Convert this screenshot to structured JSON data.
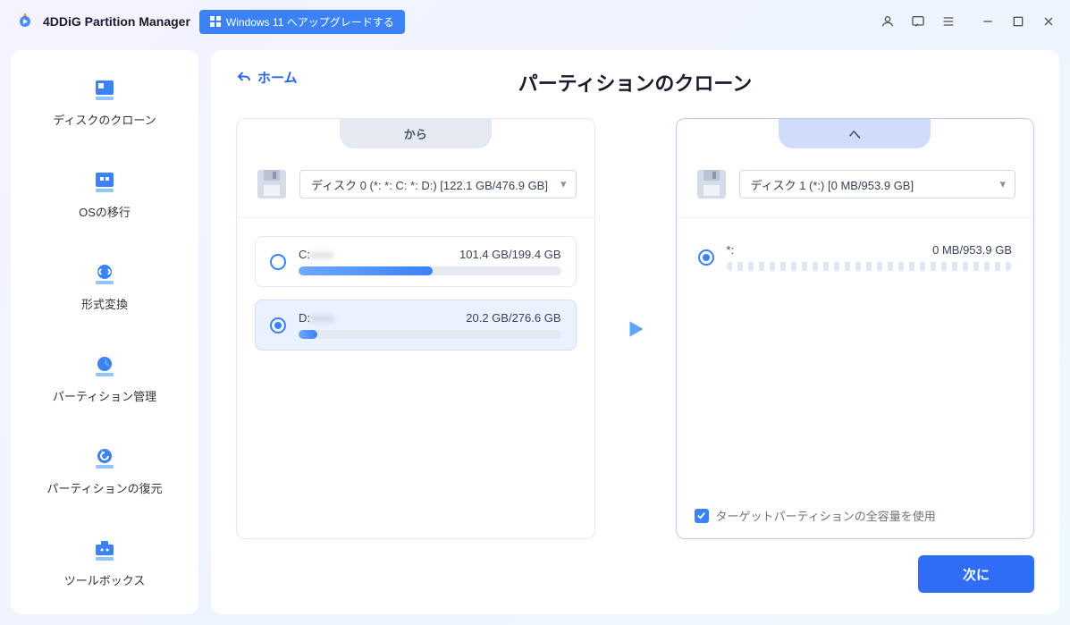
{
  "app": {
    "title": "4DDiG Partition Manager",
    "upgrade_label": "Windows 11 へアップグレードする"
  },
  "sidebar": {
    "items": [
      {
        "label": "ディスクのクローン"
      },
      {
        "label": "OSの移行"
      },
      {
        "label": "形式変換"
      },
      {
        "label": "パーティション管理"
      },
      {
        "label": "パーティションの復元"
      },
      {
        "label": "ツールボックス"
      }
    ]
  },
  "main": {
    "home_label": "ホーム",
    "page_title": "パーティションのクローン",
    "source": {
      "tab": "から",
      "disk_selected": "ディスク 0 (*: *: C: *: D:) [122.1 GB/476.9 GB]",
      "partitions": [
        {
          "name": "C:",
          "size": "101.4 GB/199.4 GB",
          "percent": 51,
          "selected": false
        },
        {
          "name": "D:",
          "size": "20.2 GB/276.6 GB",
          "percent": 7,
          "selected": true
        }
      ]
    },
    "target": {
      "tab": "へ",
      "disk_selected": "ディスク 1 (*:) [0 MB/953.9 GB]",
      "partitions": [
        {
          "name": "*:",
          "size": "0 MB/953.9 GB",
          "percent": 0,
          "selected": true
        }
      ],
      "full_capacity_label": "ターゲットパーティションの全容量を使用",
      "full_capacity_checked": true
    },
    "next_label": "次に"
  }
}
